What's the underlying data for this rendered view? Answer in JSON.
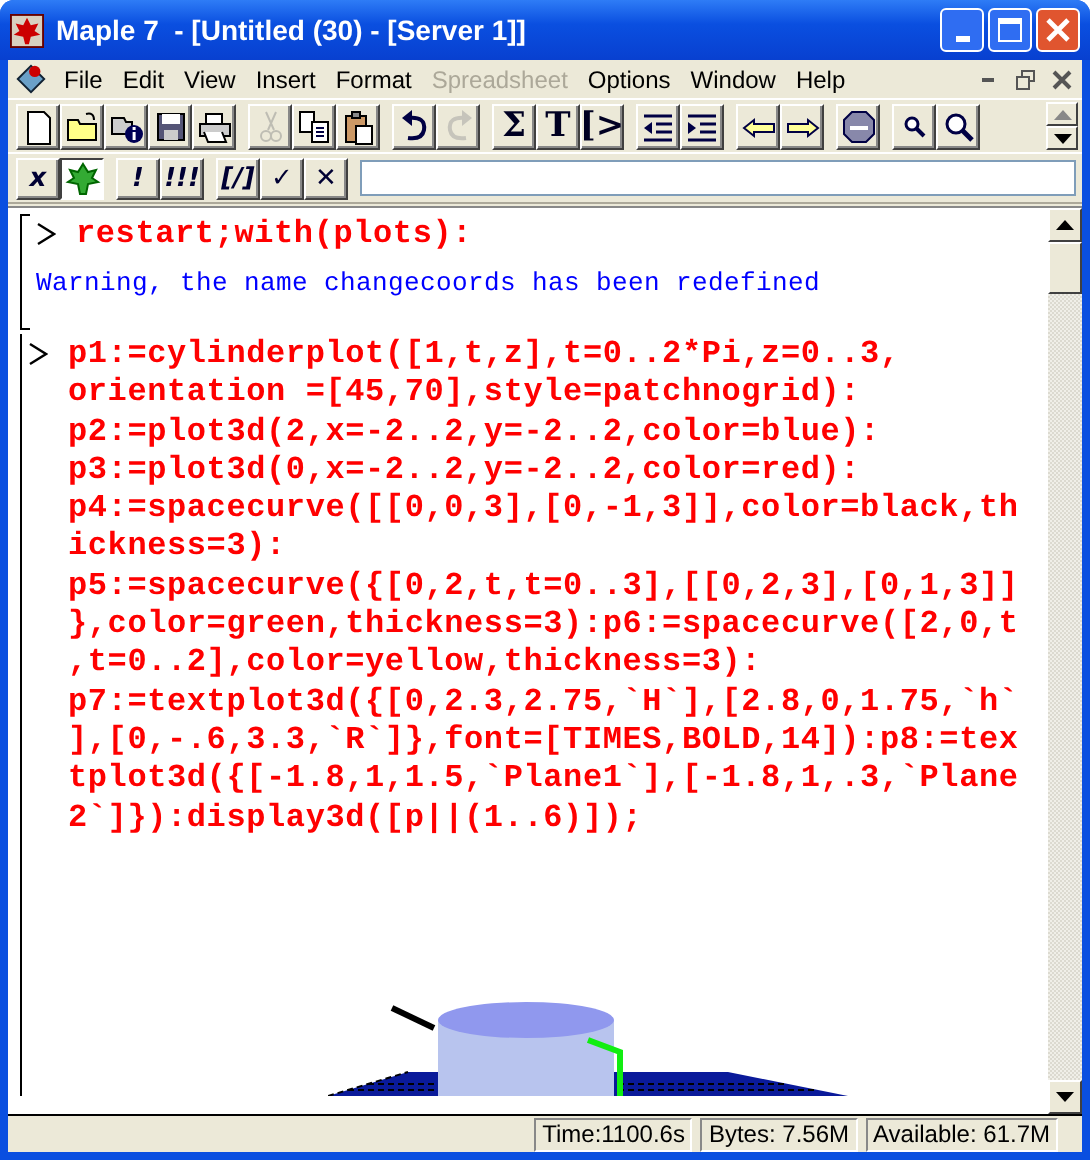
{
  "window": {
    "title": "Maple 7  - [Untitled (30) - [Server 1]]"
  },
  "menu": [
    {
      "label": "File",
      "disabled": false
    },
    {
      "label": "Edit",
      "disabled": false
    },
    {
      "label": "View",
      "disabled": false
    },
    {
      "label": "Insert",
      "disabled": false
    },
    {
      "label": "Format",
      "disabled": false
    },
    {
      "label": "Spreadsheet",
      "disabled": true
    },
    {
      "label": "Options",
      "disabled": false
    },
    {
      "label": "Window",
      "disabled": false
    },
    {
      "label": "Help",
      "disabled": false
    }
  ],
  "toolbar": [
    [
      {
        "disabled": false
      },
      {
        "disabled": false
      },
      {
        "disabled": false
      },
      {
        "disabled": false
      },
      {
        "disabled": false
      }
    ],
    [
      {
        "disabled": true
      },
      {
        "disabled": false
      },
      {
        "disabled": false
      }
    ],
    [
      {
        "disabled": false
      },
      {
        "disabled": true
      }
    ],
    [
      {
        "label": "Σ",
        "disabled": false
      },
      {
        "label": "T",
        "disabled": false
      },
      {
        "label": "[>",
        "disabled": false
      }
    ],
    [
      {
        "disabled": false
      },
      {
        "disabled": false
      }
    ],
    [
      {
        "disabled": false
      },
      {
        "disabled": false
      }
    ],
    [
      {
        "disabled": false
      }
    ],
    [
      {
        "disabled": false
      },
      {
        "disabled": false
      }
    ]
  ],
  "context_bar": {
    "groups": [
      [
        {
          "label": "x",
          "pressed": false
        },
        {
          "pressed": true
        }
      ],
      [
        {
          "label": "!"
        },
        {
          "label": "!!!"
        }
      ],
      [
        {
          "label": "[/]"
        },
        {
          "label": "✓"
        },
        {
          "label": "✕"
        }
      ]
    ]
  },
  "groups": [
    {
      "input": [
        "restart;with(plots):"
      ],
      "output": "Warning, the name changecoords has been redefined"
    },
    {
      "input": [
        "p1:=cylinderplot([1,t,z],t=0..2*Pi,z=0..3,",
        "orientation =[45,70],style=patchnogrid):",
        "p2:=plot3d(2,x=-2..2,y=-2..2,color=blue):",
        "p3:=plot3d(0,x=-2..2,y=-2..2,color=red):",
        "p4:=spacecurve([[0,0,3],[0,-1,3]],color=black,th",
        "ickness=3):",
        "p5:=spacecurve({[0,2,t,t=0..3],[[0,2,3],[0,1,3]]",
        "},color=green,thickness=3):p6:=spacecurve([2,0,t",
        ",t=0..2],color=yellow,thickness=3):",
        "p7:=textplot3d({[0,2.3,2.75,`H`],[2.8,0,1.75,`h`",
        "],[0,-.6,3.3,`R`]},font=[TIMES,BOLD,14]):p8:=tex",
        "tplot3d({[-1.8,1,1.5,`Plane1`],[-1.8,1,.3,`Plane",
        "2`]}):display3d([p||(1..6)]);"
      ]
    }
  ],
  "status_bar": [
    "Time:1100.6s",
    "Bytes: 7.56M",
    "Available: 61.7M"
  ]
}
